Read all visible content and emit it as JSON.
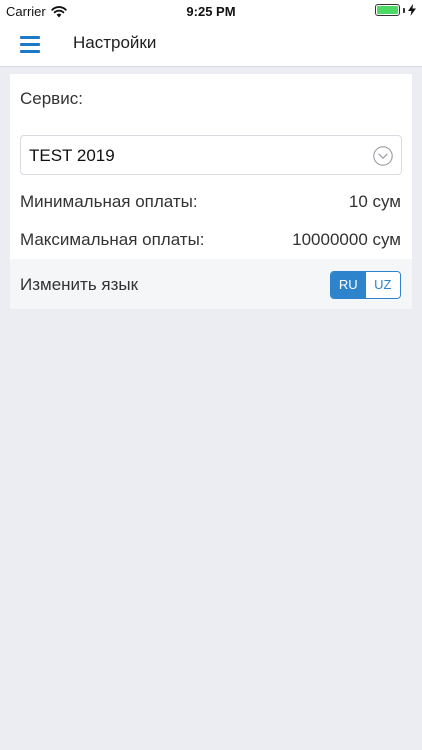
{
  "status_bar": {
    "carrier": "Carrier",
    "time": "9:25 PM",
    "battery_level": 1.0
  },
  "nav": {
    "title": "Настройки",
    "menu_icon": "hamburger-menu-icon"
  },
  "settings": {
    "service_label": "Сервис:",
    "service_value": "TEST 2019",
    "min_payment_label": "Минимальная оплаты:",
    "min_payment_value": "10 сум",
    "max_payment_label": "Максимальная оплаты:",
    "max_payment_value": "10000000 сум",
    "change_language_label": "Изменить язык",
    "languages": [
      "RU",
      "UZ"
    ],
    "selected_language": "RU"
  },
  "colors": {
    "accent": "#2e84cc",
    "background": "#ecedf2",
    "battery": "#4cd964"
  }
}
